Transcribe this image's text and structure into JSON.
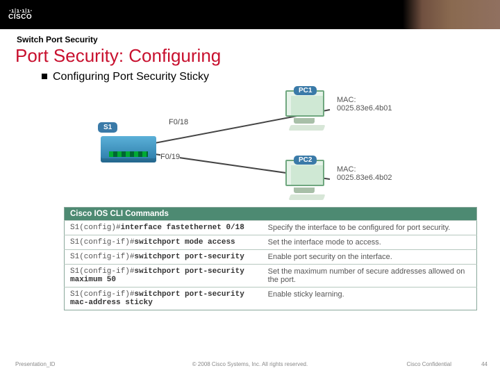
{
  "eyebrow": "Switch Port Security",
  "title": "Port Security: Configuring",
  "bullet": "Configuring Port Security Sticky",
  "diagram": {
    "switch_label": "S1",
    "port_a": "F0/18",
    "port_b": "F0/19",
    "pc1_label": "PC1",
    "pc2_label": "PC2",
    "mac1_label": "MAC:",
    "mac1_value": "0025.83e6.4b01",
    "mac2_label": "MAC:",
    "mac2_value": "0025.83e6.4b02"
  },
  "table": {
    "header": "Cisco IOS CLI Commands",
    "rows": [
      {
        "prompt": "S1(config)#",
        "cmd": "interface fastethernet 0/18",
        "desc": "Specify the interface to be configured for port security."
      },
      {
        "prompt": "S1(config-if)#",
        "cmd": "switchport mode access",
        "desc": "Set the interface mode to access."
      },
      {
        "prompt": "S1(config-if)#",
        "cmd": "switchport port-security",
        "desc": "Enable port security on the interface."
      },
      {
        "prompt": "S1(config-if)#",
        "cmd": "switchport port-security maximum 50",
        "desc": "Set the maximum number of secure addresses allowed on the port."
      },
      {
        "prompt": "S1(config-if)#",
        "cmd": "switchport port-security mac-address sticky",
        "desc": "Enable sticky learning."
      }
    ]
  },
  "footer": {
    "pid": "Presentation_ID",
    "copy": "© 2008 Cisco Systems, Inc. All rights reserved.",
    "conf": "Cisco Confidential",
    "page": "44"
  }
}
